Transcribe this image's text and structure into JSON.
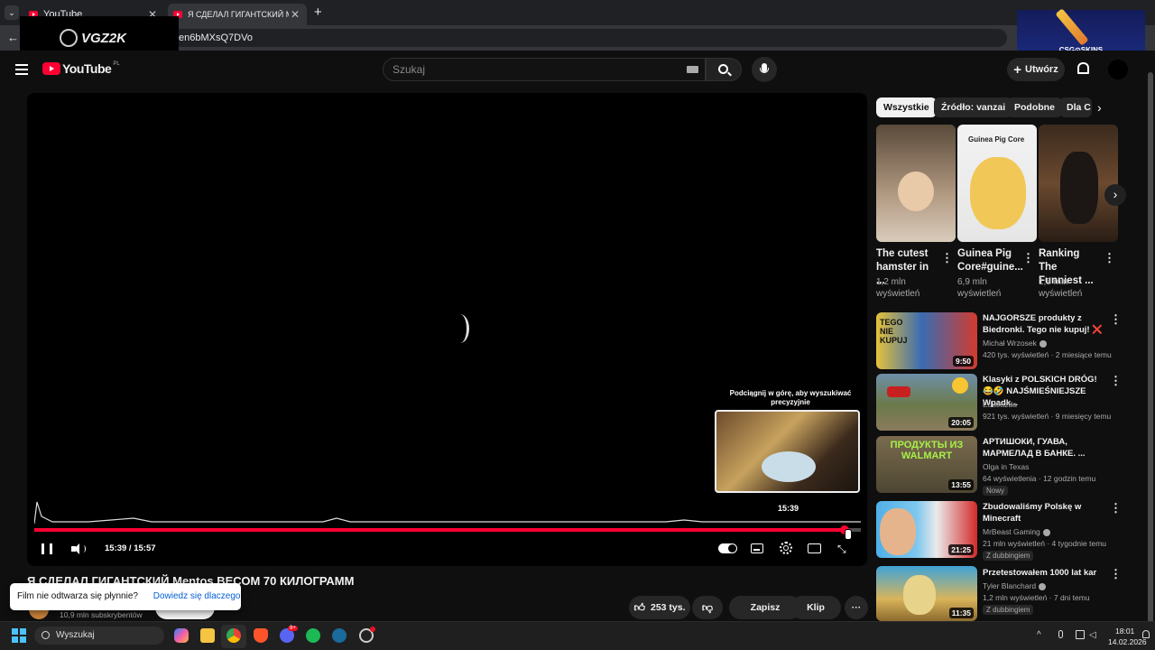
{
  "browser": {
    "tabs": [
      {
        "label": "YouTube",
        "close": "✕"
      },
      {
        "label": "Я СДЕЛАЛ ГИГАНТСКИЙ Mentos",
        "close": "✕"
      }
    ],
    "new_tab": "+",
    "url": "en6bMXsQ7DVo",
    "overlay_logo": "VGZ2K",
    "ad_text": "CSG⊙SKINS"
  },
  "header": {
    "logo": "YouTube",
    "region": "PL",
    "search_placeholder": "Szukaj",
    "create_label": "Utwórz"
  },
  "player": {
    "time": "15:39 / 15:57",
    "scrub_hint": "Podciągnij w górę, aby wyszukiwać precyzyjnie",
    "preview_time": "15:39",
    "progress_fraction": 0.98
  },
  "video": {
    "title": "Я СДЕЛАЛ ГИГАНТСКИЙ Mentos ВЕСОМ 70 КИЛОГРАММ",
    "subscribers": "10,9 mln subskrybentów",
    "likes": "253 tys.",
    "save_label": "Zapisz",
    "clip_label": "Klip",
    "more_label": "···"
  },
  "toast": {
    "message": "Film nie odtwarza się płynnie?",
    "link": "Dowiedz się dlaczego"
  },
  "chips": [
    "Wszystkie",
    "Źródło: vanzai",
    "Podobne",
    "Dla C"
  ],
  "shorts": [
    {
      "title": "The cutest hamster in ...",
      "views": "1,2 mln",
      "views2": "wyświetleń"
    },
    {
      "title": "Guinea Pig Core#guine...",
      "views": "6,9 mln",
      "views2": "wyświetleń",
      "thumb_text": "Guinea Pig Core"
    },
    {
      "title": "Ranking The Funniest ...",
      "views": "1,5 mln",
      "views2": "wyświetleń"
    }
  ],
  "videos": [
    {
      "title": "NAJGORSZE produkty z Biedronki. Tego nie kupuj! ❌",
      "channel": "Michał Wrzosek",
      "meta": "420 tys. wyświetleń · 2 miesiące temu",
      "duration": "9:50",
      "thumb_text": "TEGO NIE KUPUJ"
    },
    {
      "title": "Klasyki z POLSKICH DRÓG! 😂🤣 NAJŚMIEŚNIEJSZE Wpadk...",
      "channel": "EduJazda",
      "meta": "921 tys. wyświetleń · 9 miesięcy temu",
      "duration": "20:05"
    },
    {
      "title": "АРТИШОКИ, ГУАВА, МАРМЕЛАД В БАНКЕ. ...",
      "channel": "Olga in Texas",
      "meta": "64 wyświetlenia · 12 godzin temu",
      "duration": "13:55",
      "badge": "Nowy",
      "thumb_text": "ПРОДУКТЫ ИЗ WALMART"
    },
    {
      "title": "Zbudowaliśmy Polskę w Minecraft",
      "channel": "MrBeast Gaming",
      "meta": "21 mln wyświetleń · 4 tygodnie temu",
      "duration": "21:25",
      "badge": "Z dubbingiem"
    },
    {
      "title": "Przetestowałem 1000 lat kar",
      "channel": "Tyler Blanchard",
      "meta": "1,2 mln wyświetleń · 7 dni temu",
      "duration": "11:35",
      "badge": "Z dubbingiem"
    }
  ],
  "taskbar": {
    "search": "Wyszukaj",
    "time": "18:01",
    "date": "14.02.2026",
    "discord_badge": "9+"
  },
  "colors": {
    "accent": "#ff0033",
    "background": "#0f0f0f"
  }
}
